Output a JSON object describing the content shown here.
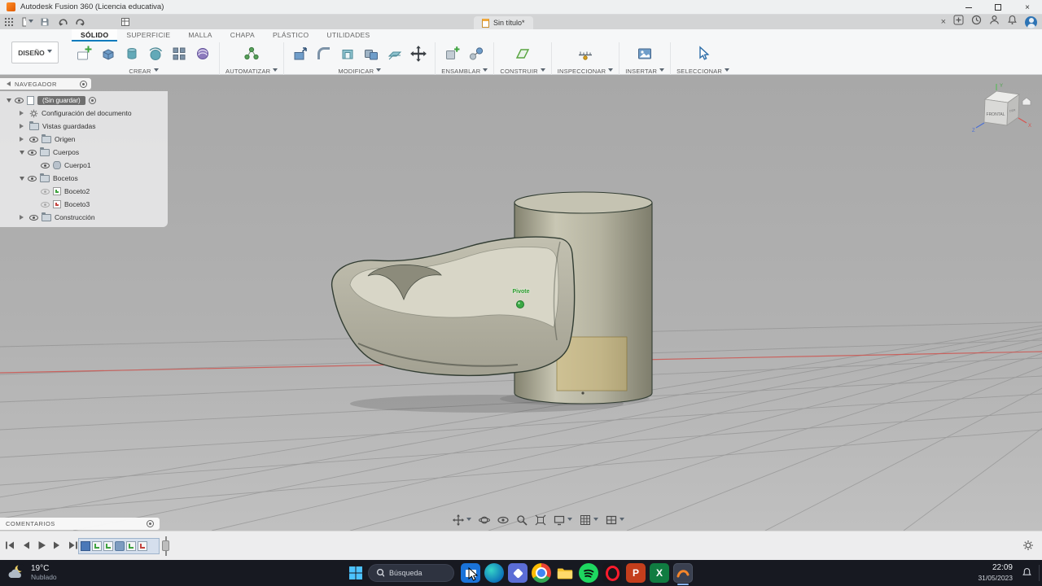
{
  "colors": {
    "accent_blue": "#0a7bbd",
    "pivot_green": "#3aa83f",
    "axis_x_red": "#d9534f",
    "axis_y_green": "#5cb85c",
    "axis_z_blue": "#4a6fd4",
    "sketch_highlight": "rgba(214,186,100,0.4)"
  },
  "window": {
    "title": "Autodesk Fusion 360 (Licencia educativa)"
  },
  "tabbar": {
    "document_tab": "Sin título*"
  },
  "ribbon": {
    "design_label": "DISEÑO",
    "tabs": [
      "SÓLIDO",
      "SUPERFICIE",
      "MALLA",
      "CHAPA",
      "PLÁSTICO",
      "UTILIDADES"
    ],
    "groups": [
      "CREAR",
      "AUTOMATIZAR",
      "MODIFICAR",
      "ENSAMBLAR",
      "CONSTRUIR",
      "INSPECCIONAR",
      "INSERTAR",
      "SELECCIONAR"
    ]
  },
  "navigator": {
    "title": "NAVEGADOR",
    "root": "(Sin guardar)",
    "items": [
      "Configuración del documento",
      "Vistas guardadas",
      "Origen",
      "Cuerpos",
      "Cuerpo1",
      "Bocetos",
      "Boceto2",
      "Boceto3",
      "Construcción"
    ]
  },
  "viewport": {
    "pivot_label": "Pivote",
    "viewcube": {
      "front": "FRONTAL",
      "right": "DER"
    },
    "axes": {
      "x": "X",
      "y": "Y",
      "z": "Z"
    }
  },
  "comments": {
    "title": "COMENTARIOS"
  },
  "taskbar": {
    "weather": {
      "temp": "19°C",
      "condition": "Nublado"
    },
    "search_placeholder": "Búsqueda",
    "clock": {
      "time": "22:09",
      "date": "31/05/2023"
    },
    "apps": [
      "mail",
      "edge",
      "photos",
      "chrome",
      "file-explorer",
      "spotify",
      "opera",
      "powerpoint",
      "excel",
      "fusion-360"
    ]
  },
  "icons": {
    "quick_access": [
      "apps-grid",
      "file-menu",
      "save",
      "undo",
      "redo",
      "data-panel"
    ],
    "account_area": [
      "close",
      "add",
      "history",
      "profile",
      "notifications",
      "avatar"
    ],
    "nav_toolbar": [
      "pan",
      "orbit",
      "look-at",
      "zoom",
      "fit",
      "display-settings",
      "grid-settings",
      "viewports"
    ],
    "timeline": [
      "go-to-start",
      "step-back",
      "play",
      "step-forward",
      "go-to-end",
      "settings-gear"
    ]
  }
}
